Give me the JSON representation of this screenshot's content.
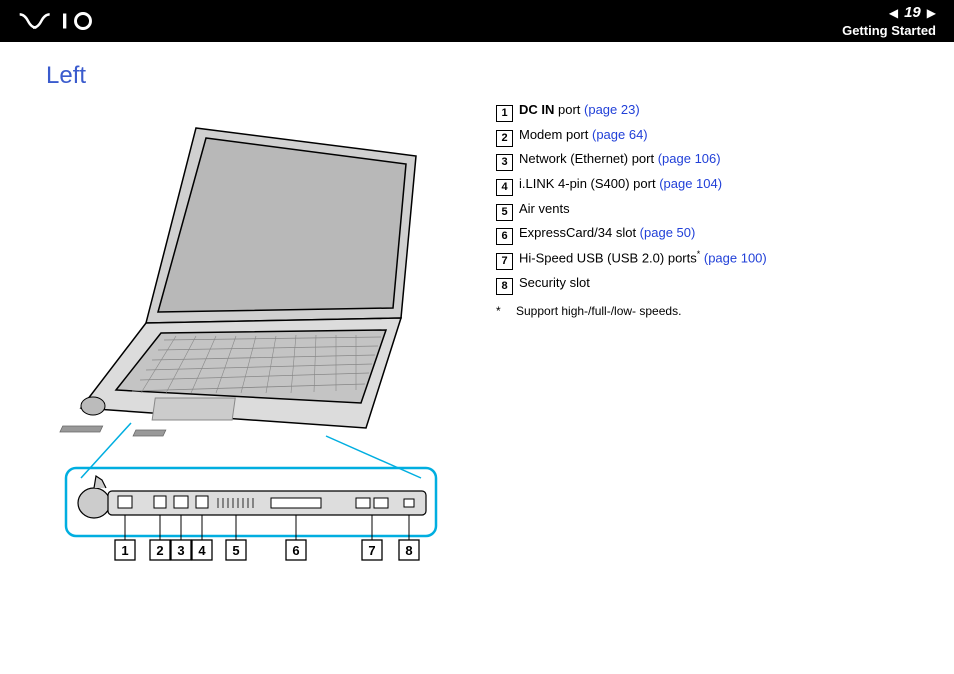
{
  "header": {
    "page_number": "19",
    "section": "Getting Started"
  },
  "title": "Left",
  "items": [
    {
      "num": "1",
      "bold": "DC IN",
      "text": " port ",
      "link": "(page 23)"
    },
    {
      "num": "2",
      "bold": "",
      "text": "Modem port ",
      "link": "(page 64)"
    },
    {
      "num": "3",
      "bold": "",
      "text": "Network (Ethernet) port ",
      "link": "(page 106)"
    },
    {
      "num": "4",
      "bold": "",
      "text": "i.LINK 4-pin (S400) port ",
      "link": "(page 104)"
    },
    {
      "num": "5",
      "bold": "",
      "text": "Air vents",
      "link": ""
    },
    {
      "num": "6",
      "bold": "",
      "text": "ExpressCard/34 slot ",
      "link": "(page 50)"
    },
    {
      "num": "7",
      "bold": "",
      "text": "Hi-Speed USB (USB 2.0) ports",
      "sup": "*",
      "link": " (page 100)"
    },
    {
      "num": "8",
      "bold": "",
      "text": "Security slot",
      "link": ""
    }
  ],
  "footnote": {
    "mark": "*",
    "text": "Support high-/full-/low- speeds."
  },
  "callouts": [
    "1",
    "2",
    "3",
    "4",
    "5",
    "6",
    "7",
    "8"
  ]
}
